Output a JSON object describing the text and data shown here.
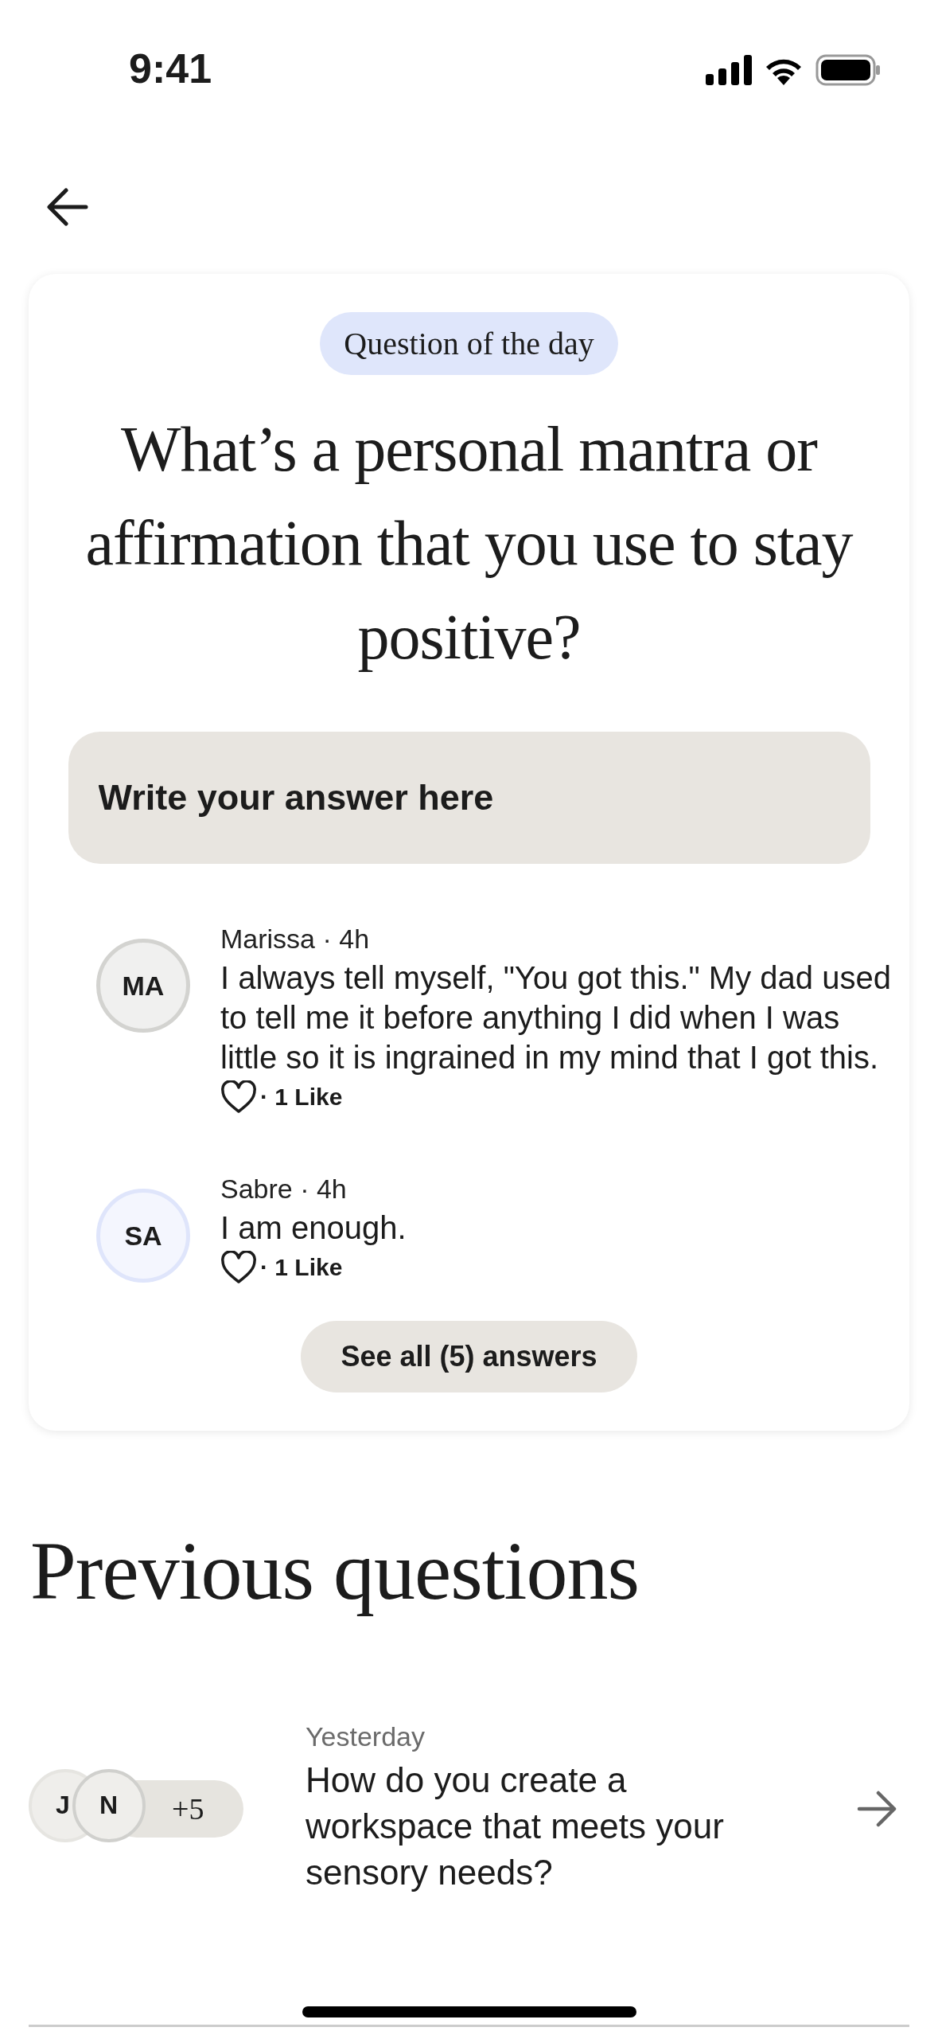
{
  "status_bar": {
    "time": "9:41"
  },
  "question_card": {
    "badge": "Question of the day",
    "question": "What’s a personal mantra or affirmation that you use to stay positive?",
    "answer_field": {
      "placeholder": "Write your answer here"
    },
    "answers": [
      {
        "initials": "MA",
        "color": "#d3d3d0",
        "meta": "Marissa · 4h",
        "text": "I always tell myself, \"You got this.\" My dad used to tell me it before anything I did when I was little so it is ingrained in my mind that I got this.",
        "likes": "· 1 Like"
      },
      {
        "initials": "SA",
        "color": "#dfe5fb",
        "meta": "Sabre · 4h",
        "text": "I am enough.",
        "likes": "· 1 Like"
      }
    ],
    "see_all_button": "See all (5) answers"
  },
  "previous_questions": {
    "title": "Previous questions",
    "items": [
      {
        "avatars": [
          "J",
          "N"
        ],
        "more": "+5",
        "date": "Yesterday",
        "question": "How do you create a workspace that meets your sensory needs?"
      }
    ]
  }
}
